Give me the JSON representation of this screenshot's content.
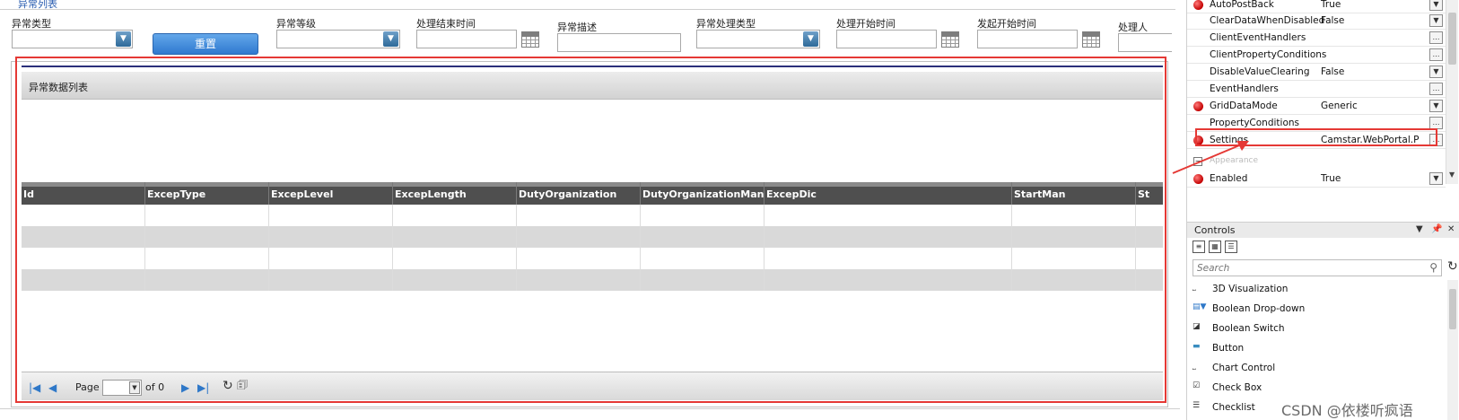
{
  "canvas": {
    "top_link": "异常列表",
    "filters": {
      "exception_type_label": "异常类型",
      "exception_level_label": "异常等级",
      "handle_end_time_label": "处理结束时间",
      "exception_desc_label": "异常描述",
      "exception_handle_type_label": "异常处理类型",
      "handle_start_time_label": "处理开始时间",
      "initiate_start_time_label": "发起开始时间",
      "handler_label": "处理人"
    },
    "reset_button": "重置",
    "grid": {
      "title": "异常数据列表",
      "columns": [
        "Id",
        "ExcepType",
        "ExcepLevel",
        "ExcepLength",
        "DutyOrganization",
        "DutyOrganizationMan",
        "ExcepDic",
        "StartMan",
        "St"
      ],
      "row_count": 4
    },
    "pager": {
      "page_label": "Page",
      "page_value": "",
      "of_label": "of 0"
    }
  },
  "properties": [
    {
      "name": "AutoPostBack",
      "value": "True",
      "button": "dropdown"
    },
    {
      "name": "ClearDataWhenDisabled",
      "value": "False",
      "button": "dropdown"
    },
    {
      "name": "ClientEventHandlers",
      "value": "",
      "button": "ellipsis"
    },
    {
      "name": "ClientPropertyConditions",
      "value": "",
      "button": "ellipsis"
    },
    {
      "name": "DisableValueClearing",
      "value": "False",
      "button": "dropdown"
    },
    {
      "name": "EventHandlers",
      "value": "",
      "button": "ellipsis"
    },
    {
      "name": "GridDataMode",
      "value": "Generic",
      "button": "dropdown"
    },
    {
      "name": "PropertyConditions",
      "value": "",
      "button": "ellipsis"
    },
    {
      "name": "Settings",
      "value": "Camstar.WebPortal.P",
      "button": "ellipsis"
    }
  ],
  "property_category": "Appearance",
  "property_after_category": {
    "name": "Enabled",
    "value": "True",
    "button": "dropdown"
  },
  "controls_panel": {
    "title": "Controls",
    "search_placeholder": "Search",
    "items": [
      {
        "label": "3D Visualization",
        "icon": "chart-3d-icon"
      },
      {
        "label": "Boolean Drop-down",
        "icon": "dropdown-icon"
      },
      {
        "label": "Boolean Switch",
        "icon": "switch-icon"
      },
      {
        "label": "Button",
        "icon": "button-icon"
      },
      {
        "label": "Chart Control",
        "icon": "chart-icon"
      },
      {
        "label": "Check Box",
        "icon": "checkbox-icon"
      },
      {
        "label": "Checklist",
        "icon": "checklist-icon"
      }
    ]
  },
  "watermark": "CSDN @依楼听疯语",
  "colors": {
    "annotation_red": "#e53935",
    "reset_button_blue": "#3a85d8",
    "grid_header": "#4f4f4f"
  }
}
